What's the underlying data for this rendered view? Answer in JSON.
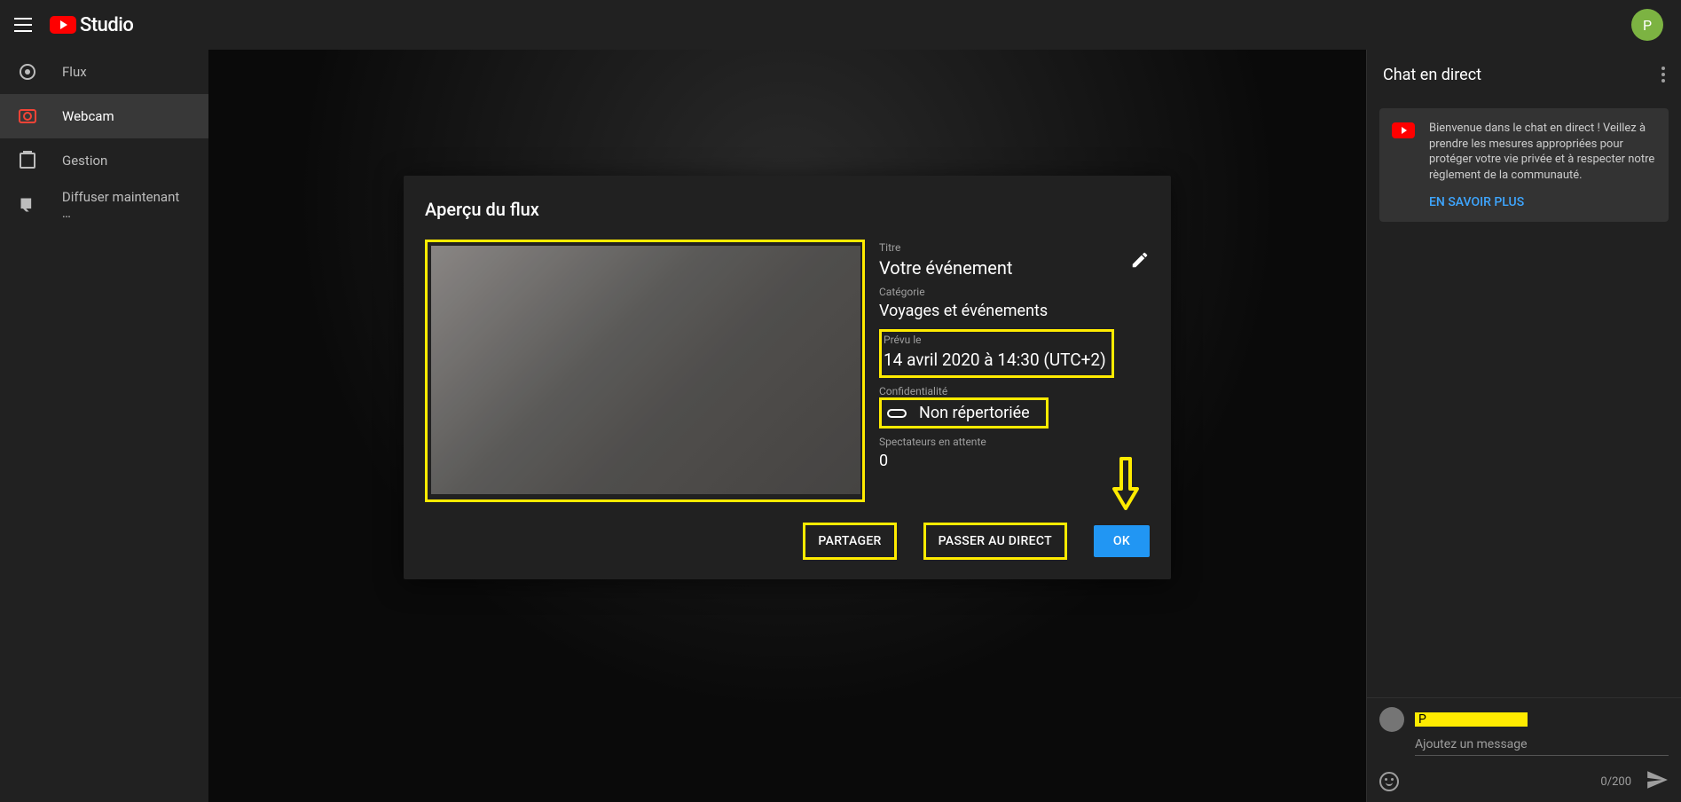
{
  "header": {
    "studio_label": "Studio",
    "avatar_letter": "P"
  },
  "sidebar": {
    "items": [
      {
        "label": "Flux"
      },
      {
        "label": "Webcam"
      },
      {
        "label": "Gestion"
      },
      {
        "label": "Diffuser maintenant …"
      }
    ]
  },
  "panel": {
    "title": "Aperçu du flux",
    "title_label": "Titre",
    "title_value": "Votre événement",
    "category_label": "Catégorie",
    "category_value": "Voyages et événements",
    "scheduled_label": "Prévu le",
    "scheduled_value": "14 avril 2020 à 14:30 (UTC+2)",
    "privacy_label": "Confidentialité",
    "privacy_value": "Non répertoriée",
    "viewers_label": "Spectateurs en attente",
    "viewers_value": "0",
    "share_btn": "PARTAGER",
    "golive_btn": "PASSER AU DIRECT",
    "ok_btn": "OK"
  },
  "chat": {
    "title": "Chat en direct",
    "welcome": "Bienvenue dans le chat en direct ! Veillez à prendre les mesures appropriées pour protéger votre vie privée et à respecter notre règlement de la communauté.",
    "learn_more": "EN SAVOIR PLUS",
    "user_prefix": "P",
    "input_placeholder": "Ajoutez un message",
    "counter": "0/200"
  }
}
